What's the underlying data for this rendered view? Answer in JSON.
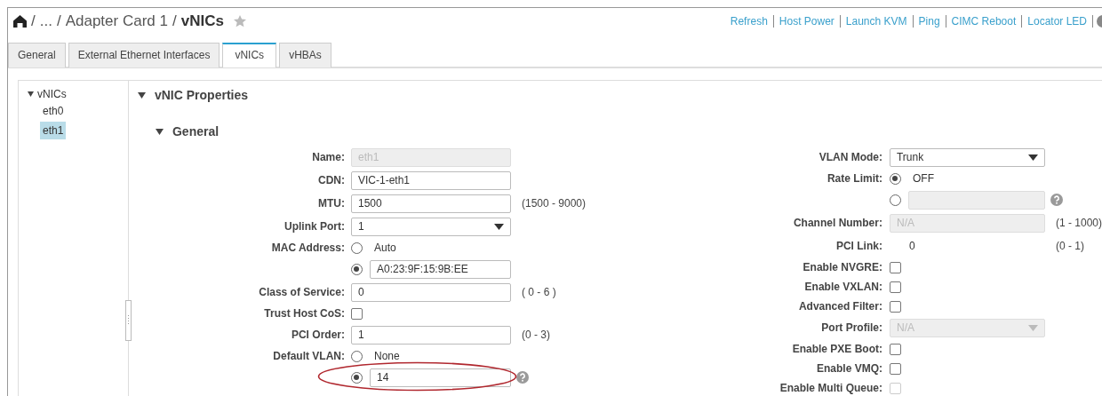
{
  "breadcrumb": {
    "separator": "/",
    "parts": [
      "...",
      "Adapter Card 1"
    ],
    "current": "vNICs"
  },
  "actions": [
    "Refresh",
    "Host Power",
    "Launch KVM",
    "Ping",
    "CIMC Reboot",
    "Locator LED"
  ],
  "tabs": [
    {
      "label": "General",
      "selected": false
    },
    {
      "label": "External Ethernet Interfaces",
      "selected": false
    },
    {
      "label": "vNICs",
      "selected": true
    },
    {
      "label": "vHBAs",
      "selected": false
    }
  ],
  "tree": {
    "label": "vNICs",
    "expanded": true,
    "children": [
      {
        "label": "eth0",
        "selected": false
      },
      {
        "label": "eth1",
        "selected": true
      }
    ]
  },
  "section": "vNIC Properties",
  "subsection": "General",
  "left_fields": [
    {
      "kind": "text",
      "label": "Name:",
      "value": "eth1",
      "disabled": true
    },
    {
      "kind": "text",
      "label": "CDN:",
      "value": "VIC-1-eth1",
      "disabled": false
    },
    {
      "kind": "text",
      "label": "MTU:",
      "value": "1500",
      "disabled": false,
      "hint": "(1500 - 9000)"
    },
    {
      "kind": "select",
      "label": "Uplink Port:",
      "value": "1",
      "disabled": false
    },
    {
      "kind": "radio",
      "label": "MAC Address:",
      "option": "Auto",
      "selected": false
    },
    {
      "kind": "radio-input",
      "value": "A0:23:9F:15:9B:EE",
      "selected": true,
      "disabled": false
    },
    {
      "kind": "text",
      "label": "Class of Service:",
      "value": "0",
      "disabled": false,
      "hint": "( 0 - 6 )"
    },
    {
      "kind": "checkbox",
      "label": "Trust Host CoS:",
      "checked": false,
      "disabled": false
    },
    {
      "kind": "text",
      "label": "PCI Order:",
      "value": "1",
      "disabled": false,
      "hint": "(0 - 3)"
    },
    {
      "kind": "radio",
      "label": "Default VLAN:",
      "option": "None",
      "selected": false
    },
    {
      "kind": "radio-input",
      "value": "14",
      "selected": true,
      "disabled": false,
      "help": true,
      "annotated": true
    }
  ],
  "right_fields": [
    {
      "kind": "select",
      "label": "VLAN Mode:",
      "value": "Trunk",
      "disabled": false
    },
    {
      "kind": "radio",
      "label": "Rate Limit:",
      "option": "OFF",
      "selected": true
    },
    {
      "kind": "radio-input",
      "selected": false,
      "disabled": true,
      "help": true
    },
    {
      "kind": "text",
      "label": "Channel Number:",
      "value": "N/A",
      "disabled": true,
      "hint": "(1 - 1000)"
    },
    {
      "kind": "static",
      "label": "PCI Link:",
      "value": "0",
      "hint": "(0 - 1)"
    },
    {
      "kind": "checkbox",
      "label": "Enable NVGRE:",
      "checked": false,
      "disabled": false
    },
    {
      "kind": "checkbox",
      "label": "Enable VXLAN:",
      "checked": false,
      "disabled": false
    },
    {
      "kind": "checkbox",
      "label": "Advanced Filter:",
      "checked": false,
      "disabled": false
    },
    {
      "kind": "select",
      "label": "Port Profile:",
      "value": "N/A",
      "disabled": true
    },
    {
      "kind": "checkbox",
      "label": "Enable PXE Boot:",
      "checked": false,
      "disabled": false
    },
    {
      "kind": "checkbox",
      "label": "Enable VMQ:",
      "checked": false,
      "disabled": false
    },
    {
      "kind": "checkbox",
      "label": "Enable Multi Queue:",
      "checked": false,
      "disabled": true
    }
  ]
}
